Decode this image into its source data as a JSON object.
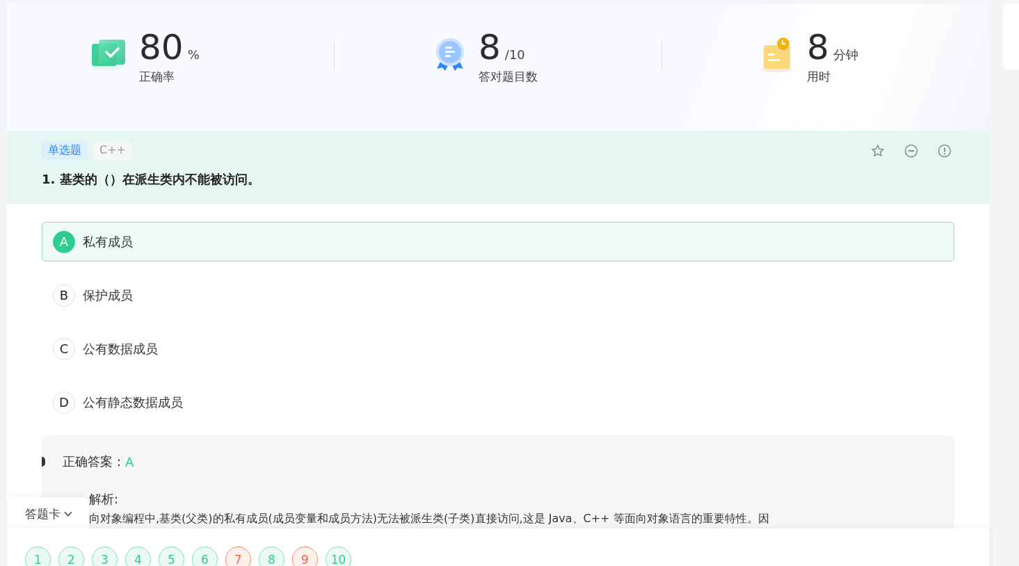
{
  "stats": [
    {
      "kind": "accuracy",
      "value": "80",
      "unit": "%",
      "label": "正确率"
    },
    {
      "kind": "correct",
      "value": "8",
      "unit": "/10",
      "label": "答对题目数"
    },
    {
      "kind": "time",
      "value": "8",
      "unit": "分钟",
      "label": "用时"
    }
  ],
  "question": {
    "tags": [
      {
        "kind": "type",
        "text": "单选题"
      },
      {
        "kind": "subject",
        "text": "C++"
      }
    ],
    "title": "1. 基类的（）在派生类内不能被访问。",
    "favorited": false
  },
  "options": [
    {
      "letter": "A",
      "text": "私有成员",
      "selected": true
    },
    {
      "letter": "B",
      "text": "保护成员",
      "selected": false
    },
    {
      "letter": "C",
      "text": "公有数据成员",
      "selected": false
    },
    {
      "letter": "D",
      "text": "公有静态数据成员",
      "selected": false
    }
  ],
  "answer": {
    "label": "正确答案：",
    "value": "A",
    "analysis_label": "解析:",
    "analysis_text": "向对象编程中,基类(父类)的私有成员(成员变量和成员方法)无法被派生类(子类)直接访问,这是 Java、C++ 等面向对象语言的重要特性。因"
  },
  "answer_card": {
    "title": "答题卡",
    "expanded": true,
    "items": [
      {
        "number": "1",
        "correct": true
      },
      {
        "number": "2",
        "correct": true
      },
      {
        "number": "3",
        "correct": true
      },
      {
        "number": "4",
        "correct": true
      },
      {
        "number": "5",
        "correct": true
      },
      {
        "number": "6",
        "correct": true
      },
      {
        "number": "7",
        "correct": false
      },
      {
        "number": "8",
        "correct": true
      },
      {
        "number": "9",
        "correct": false
      },
      {
        "number": "10",
        "correct": true
      }
    ]
  }
}
